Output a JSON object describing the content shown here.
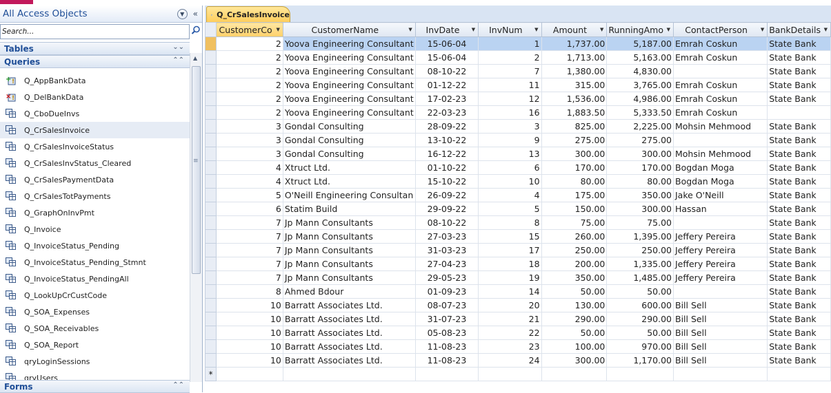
{
  "nav": {
    "title": "All Access Objects",
    "search_placeholder": "Search...",
    "groups": {
      "tables": "Tables",
      "queries": "Queries",
      "forms": "Forms"
    },
    "queries": [
      {
        "label": "Q_AppBankData",
        "icon": "append-query-icon"
      },
      {
        "label": "Q_DelBankData",
        "icon": "delete-query-icon"
      },
      {
        "label": "Q_CboDueInvs",
        "icon": "select-query-icon"
      },
      {
        "label": "Q_CrSalesInvoice",
        "icon": "select-query-icon"
      },
      {
        "label": "Q_CrSalesInvoiceStatus",
        "icon": "select-query-icon"
      },
      {
        "label": "Q_CrSalesInvStatus_Cleared",
        "icon": "select-query-icon"
      },
      {
        "label": "Q_CrSalesPaymentData",
        "icon": "select-query-icon"
      },
      {
        "label": "Q_CrSalesTotPayments",
        "icon": "select-query-icon"
      },
      {
        "label": "Q_GraphOnInvPmt",
        "icon": "select-query-icon"
      },
      {
        "label": "Q_Invoice",
        "icon": "select-query-icon"
      },
      {
        "label": "Q_InvoiceStatus_Pending",
        "icon": "select-query-icon"
      },
      {
        "label": "Q_InvoiceStatus_Pending_Stmnt",
        "icon": "select-query-icon"
      },
      {
        "label": "Q_InvoiceStatus_PendingAll",
        "icon": "select-query-icon"
      },
      {
        "label": "Q_LookUpCrCustCode",
        "icon": "select-query-icon"
      },
      {
        "label": "Q_SOA_Expenses",
        "icon": "select-query-icon"
      },
      {
        "label": "Q_SOA_Receivables",
        "icon": "select-query-icon"
      },
      {
        "label": "Q_SOA_Report",
        "icon": "select-query-icon"
      },
      {
        "label": "qryLoginSessions",
        "icon": "select-query-icon"
      },
      {
        "label": "qryUsers",
        "icon": "select-query-icon"
      }
    ]
  },
  "tab": {
    "label": "Q_CrSalesInvoice"
  },
  "columns": [
    "CustomerCo",
    "CustomerName",
    "InvDate",
    "InvNum",
    "Amount",
    "RunningAmo",
    "ContactPerson",
    "BankDetails"
  ],
  "rows": [
    [
      "2",
      "Yoova Engineering Consultant",
      "15-06-04",
      "1",
      "1,737.00",
      "5,187.00",
      "Emrah Coskun",
      "State Bank"
    ],
    [
      "2",
      "Yoova Engineering Consultant",
      "15-06-04",
      "2",
      "1,713.00",
      "5,163.00",
      "Emrah Coskun",
      "State Bank"
    ],
    [
      "2",
      "Yoova Engineering Consultant",
      "08-10-22",
      "7",
      "1,380.00",
      "4,830.00",
      "",
      "State Bank"
    ],
    [
      "2",
      "Yoova Engineering Consultant",
      "01-12-22",
      "11",
      "315.00",
      "3,765.00",
      "Emrah Coskun",
      "State Bank"
    ],
    [
      "2",
      "Yoova Engineering Consultant",
      "17-02-23",
      "12",
      "1,536.00",
      "4,986.00",
      "Emrah Coskun",
      "State Bank"
    ],
    [
      "2",
      "Yoova Engineering Consultant",
      "22-03-23",
      "16",
      "1,883.50",
      "5,333.50",
      "Emrah Coskun",
      ""
    ],
    [
      "3",
      "Gondal Consulting",
      "28-09-22",
      "3",
      "825.00",
      "2,225.00",
      "Mohsin Mehmood",
      "State Bank"
    ],
    [
      "3",
      "Gondal Consulting",
      "13-10-22",
      "9",
      "275.00",
      "275.00",
      "",
      "State Bank"
    ],
    [
      "3",
      "Gondal Consulting",
      "16-12-22",
      "13",
      "300.00",
      "300.00",
      "Mohsin Mehmood",
      "State Bank"
    ],
    [
      "4",
      "Xtruct Ltd.",
      "01-10-22",
      "6",
      "170.00",
      "170.00",
      "Bogdan Moga",
      "State Bank"
    ],
    [
      "4",
      "Xtruct Ltd.",
      "15-10-22",
      "10",
      "80.00",
      "80.00",
      "Bogdan Moga",
      "State Bank"
    ],
    [
      "5",
      "O'Neill Engineering Consultan",
      "26-09-22",
      "4",
      "175.00",
      "350.00",
      "Jake O'Neill",
      "State Bank"
    ],
    [
      "6",
      "Statim Build",
      "29-09-22",
      "5",
      "150.00",
      "300.00",
      "Hassan",
      "State Bank"
    ],
    [
      "7",
      "Jp Mann Consultants",
      "08-10-22",
      "8",
      "75.00",
      "75.00",
      "",
      "State Bank"
    ],
    [
      "7",
      "Jp Mann Consultants",
      "27-03-23",
      "15",
      "260.00",
      "1,395.00",
      "Jeffery Pereira",
      "State Bank"
    ],
    [
      "7",
      "Jp Mann Consultants",
      "31-03-23",
      "17",
      "250.00",
      "250.00",
      "Jeffery Pereira",
      "State Bank"
    ],
    [
      "7",
      "Jp Mann Consultants",
      "27-04-23",
      "18",
      "200.00",
      "1,335.00",
      "Jeffery Pereira",
      "State Bank"
    ],
    [
      "7",
      "Jp Mann Consultants",
      "29-05-23",
      "19",
      "350.00",
      "1,485.00",
      "Jeffery Pereira",
      "State Bank"
    ],
    [
      "8",
      "Ahmed Bdour",
      "01-09-23",
      "14",
      "50.00",
      "50.00",
      "",
      "State Bank"
    ],
    [
      "10",
      "Barratt Associates Ltd.",
      "08-07-23",
      "20",
      "130.00",
      "600.00",
      "Bill Sell",
      "State Bank"
    ],
    [
      "10",
      "Barratt Associates Ltd.",
      "31-07-23",
      "21",
      "290.00",
      "290.00",
      "Bill Sell",
      "State Bank"
    ],
    [
      "10",
      "Barratt Associates Ltd.",
      "05-08-23",
      "22",
      "50.00",
      "50.00",
      "Bill Sell",
      "State Bank"
    ],
    [
      "10",
      "Barratt Associates Ltd.",
      "11-08-23",
      "23",
      "100.00",
      "970.00",
      "Bill Sell",
      "State Bank"
    ],
    [
      "10",
      "Barratt Associates Ltd.",
      "11-08-23",
      "24",
      "300.00",
      "1,170.00",
      "Bill Sell",
      "State Bank"
    ]
  ],
  "new_row_marker": "*"
}
